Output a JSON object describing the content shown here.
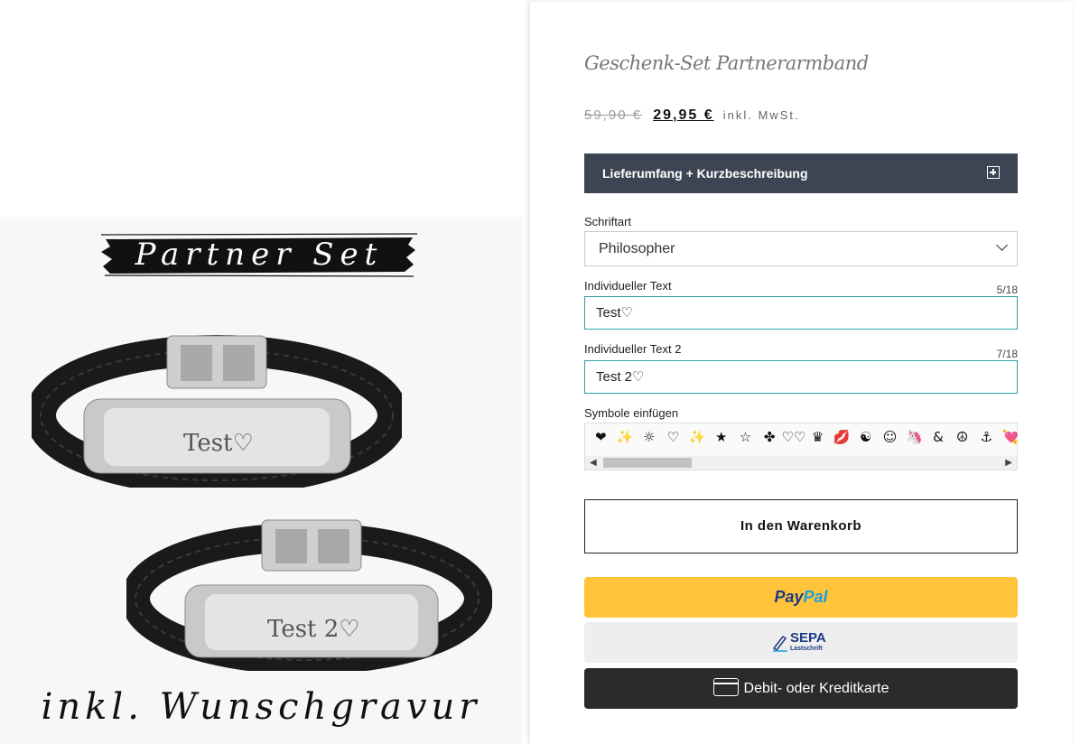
{
  "product": {
    "banner_text": "Partner Set",
    "bottom_text": "inkl. Wunschgravur",
    "engraving_1": "Test♡",
    "engraving_2": "Test 2♡",
    "title": "Geschenk-Set Partnerarmband",
    "old_price": "59,90 €",
    "new_price": "29,95 €",
    "tax_note": "inkl. MwSt."
  },
  "accordion": {
    "label": "Lieferumfang + Kurzbeschreibung"
  },
  "font_select": {
    "label": "Schriftart",
    "value": "Philosopher"
  },
  "text1": {
    "label": "Individueller Text",
    "counter": "5/18",
    "value": "Test♡"
  },
  "text2": {
    "label": "Individueller Text 2",
    "counter": "7/18",
    "value": "Test 2♡"
  },
  "symbols": {
    "label": "Symbole einfügen",
    "items": [
      "❤",
      "✨",
      "☼",
      "♡",
      "✨",
      "★",
      "☆",
      "✤",
      "♡♡",
      "♛",
      "💋",
      "☯",
      "☺",
      "🦄",
      "&",
      "☮",
      "⚓",
      "💘"
    ]
  },
  "buttons": {
    "cart": "In den Warenkorb",
    "paypal_pay": "Pay",
    "paypal_pal": "Pal",
    "sepa_big": "SEPA",
    "sepa_small": "Lastschrift",
    "card": "Debit- oder Kreditkarte"
  },
  "colors": {
    "accent": "#3d4554",
    "input_border": "#2aa3a8",
    "paypal": "#ffc43a",
    "card": "#2b2b2b"
  }
}
